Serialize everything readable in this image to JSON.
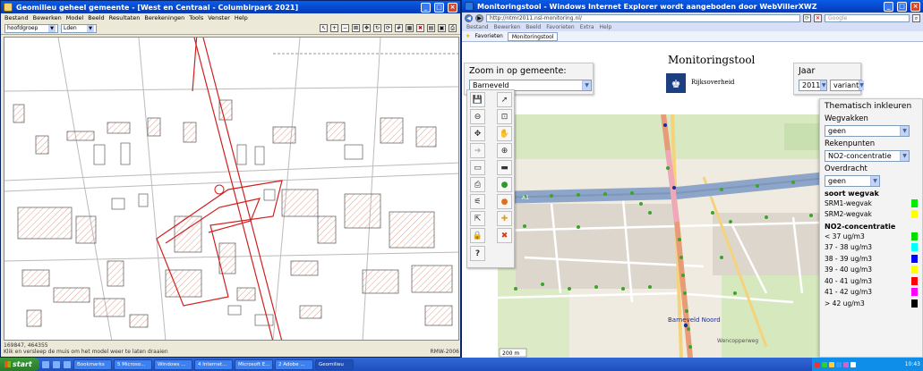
{
  "left_window": {
    "title": "Geomilieu  geheel gemeente - [West en Centraal - Columbirpark 2021]",
    "menu": [
      "Bestand",
      "Bewerken",
      "Model",
      "Beeld",
      "Resultaten",
      "Berekeningen",
      "Tools",
      "Venster",
      "Help"
    ],
    "group_combo": "hoofdgroep",
    "period_combo": "Lden",
    "status_coords": "169847, 464355",
    "status_hint": "Klik en versleep de muis om het model weer te laten draaien",
    "status_right": "RMW-2006"
  },
  "right_window": {
    "title": "Monitoringstool - Windows Internet Explorer wordt aangeboden door WebVillerXWZ",
    "url": "http://ntmr2011.nsl-monitoring.nl/",
    "search_placeholder": "Google",
    "menu": [
      "Bestand",
      "Bewerken",
      "Beeld",
      "Favorieten",
      "Extra",
      "Help"
    ],
    "favorites_label": "Favorieten",
    "tab_label": "Monitoringstool",
    "zoom_title": "Zoom in op gemeente:",
    "zoom_value": "Barneveld",
    "app_title": "Monitoringstool",
    "org_name": "Rijksoverheid",
    "year_title": "Jaar",
    "year_value": "2011",
    "variant_value": "variant",
    "thematisch_title": "Thematisch inkleuren",
    "wegvakken_label": "Wegvakken",
    "wegvakken_value": "geen",
    "rekenpunten_label": "Rekenpunten",
    "rekenpunten_value": "NO2-concentratie",
    "overdracht_label": "Overdracht",
    "overdracht_value": "geen",
    "legend_wegvak_title": "soort wegvak",
    "legend_wegvak": [
      {
        "label": "SRM1-wegvak",
        "color": "#00ee00"
      },
      {
        "label": "SRM2-wegvak",
        "color": "#ffff00"
      }
    ],
    "legend_no2_title": "NO2-concentratie",
    "legend_no2": [
      {
        "label": "< 37 ug/m3",
        "color": "#00e000"
      },
      {
        "label": "37 - 38 ug/m3",
        "color": "#00ffff"
      },
      {
        "label": "38 - 39 ug/m3",
        "color": "#0000ff"
      },
      {
        "label": "39 - 40 ug/m3",
        "color": "#ffff00"
      },
      {
        "label": "40 - 41 ug/m3",
        "color": "#ff0000"
      },
      {
        "label": "41 - 42 ug/m3",
        "color": "#ff00ff"
      },
      {
        "label": "> 42 ug/m3",
        "color": "#000000"
      }
    ],
    "map_place_label": "Barneveld Noord",
    "map_road_label": "A1",
    "map_street_label": "Wencopperweg",
    "scale_label": "200 m"
  },
  "taskbar": {
    "start_label": "start",
    "tasks": [
      "Bookmarks",
      "5 Microso...",
      "Windows ...",
      "4 Internet...",
      "Microsoft E...",
      "2 Adobe ...",
      "Geomilieu"
    ],
    "clock": "10:43"
  }
}
